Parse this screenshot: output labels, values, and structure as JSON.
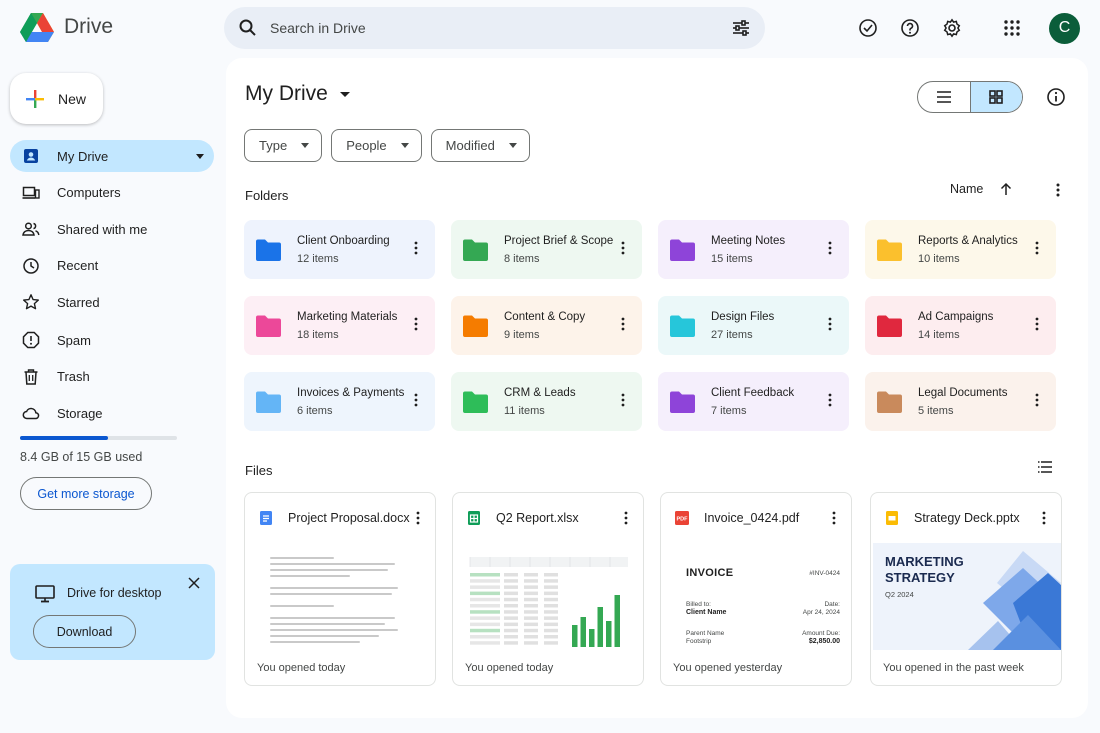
{
  "app": {
    "name": "Drive"
  },
  "search": {
    "placeholder": "Search in Drive"
  },
  "account": {
    "initial": "C"
  },
  "sidebar": {
    "new_label": "New",
    "items": [
      {
        "label": "My Drive",
        "icon": "my-drive-icon"
      },
      {
        "label": "Computers",
        "icon": "computers-icon"
      },
      {
        "label": "Shared with me",
        "icon": "shared-icon"
      },
      {
        "label": "Recent",
        "icon": "clock-icon"
      },
      {
        "label": "Starred",
        "icon": "star-icon"
      },
      {
        "label": "Spam",
        "icon": "spam-icon"
      },
      {
        "label": "Trash",
        "icon": "trash-icon"
      },
      {
        "label": "Storage",
        "icon": "cloud-icon"
      }
    ],
    "storage": {
      "used_fraction": 0.56,
      "text": "8.4 GB of 15 GB used",
      "button": "Get more storage"
    },
    "desktop": {
      "label": "Drive for desktop",
      "button": "Download"
    }
  },
  "main": {
    "title": "My Drive",
    "filters": [
      "Type",
      "People",
      "Modified"
    ],
    "folders_title": "Folders",
    "sort_label": "Name",
    "files_title": "Files",
    "folders": [
      {
        "name": "Client Onboarding",
        "count": "12 items",
        "color": "#1a73e8",
        "bg": "#eef3fd"
      },
      {
        "name": "Project Brief & Scope",
        "count": "8 items",
        "color": "#34a853",
        "bg": "#eef8f1"
      },
      {
        "name": "Meeting Notes",
        "count": "15 items",
        "color": "#8e44d9",
        "bg": "#f5effc"
      },
      {
        "name": "Reports & Analytics",
        "count": "10 items",
        "color": "#fbc02d",
        "bg": "#fdf8ea"
      },
      {
        "name": "Marketing Materials",
        "count": "18 items",
        "color": "#ec4899",
        "bg": "#fdeff5"
      },
      {
        "name": "Content & Copy",
        "count": "9 items",
        "color": "#f57c00",
        "bg": "#fdf3ea"
      },
      {
        "name": "Design Files",
        "count": "27 items",
        "color": "#26c6da",
        "bg": "#ebf8f9"
      },
      {
        "name": "Ad Campaigns",
        "count": "14 items",
        "color": "#e0283e",
        "bg": "#fdedef"
      },
      {
        "name": "Invoices & Payments",
        "count": "6 items",
        "color": "#64b5f6",
        "bg": "#eef5fd"
      },
      {
        "name": "CRM & Leads",
        "count": "11 items",
        "color": "#2ebd59",
        "bg": "#eef8f1"
      },
      {
        "name": "Client Feedback",
        "count": "7 items",
        "color": "#8e44d9",
        "bg": "#f5effc"
      },
      {
        "name": "Legal Documents",
        "count": "5 items",
        "color": "#c98a5c",
        "bg": "#fbf2ec"
      }
    ],
    "files": [
      {
        "name": "Project Proposal.docx",
        "type": "doc-icon",
        "color": "#4285f4",
        "caption": "You opened today"
      },
      {
        "name": "Q2 Report.xlsx",
        "type": "sheet-icon",
        "color": "#0f9d58",
        "caption": "You opened today"
      },
      {
        "name": "Invoice_0424.pdf",
        "type": "pdf-icon",
        "color": "#ea4335",
        "caption": "You opened yesterday"
      },
      {
        "name": "Strategy Deck.pptx",
        "type": "slides-icon",
        "color": "#fbbc04",
        "caption": "You opened in the past week"
      }
    ],
    "invoice_thumb": {
      "title": "INVOICE",
      "number": "#INV-0424",
      "billed_to": "Billed to:",
      "client": "Client Name",
      "date_label": "Date:",
      "date": "Apr 24, 2024",
      "person": "Parent Name",
      "foot": "Footstrip",
      "amount_label": "Amount Due:",
      "amount": "$2,850.00"
    },
    "deck_thumb": {
      "title": "MARKETING STRATEGY",
      "subtitle": "Q2 2024"
    }
  }
}
